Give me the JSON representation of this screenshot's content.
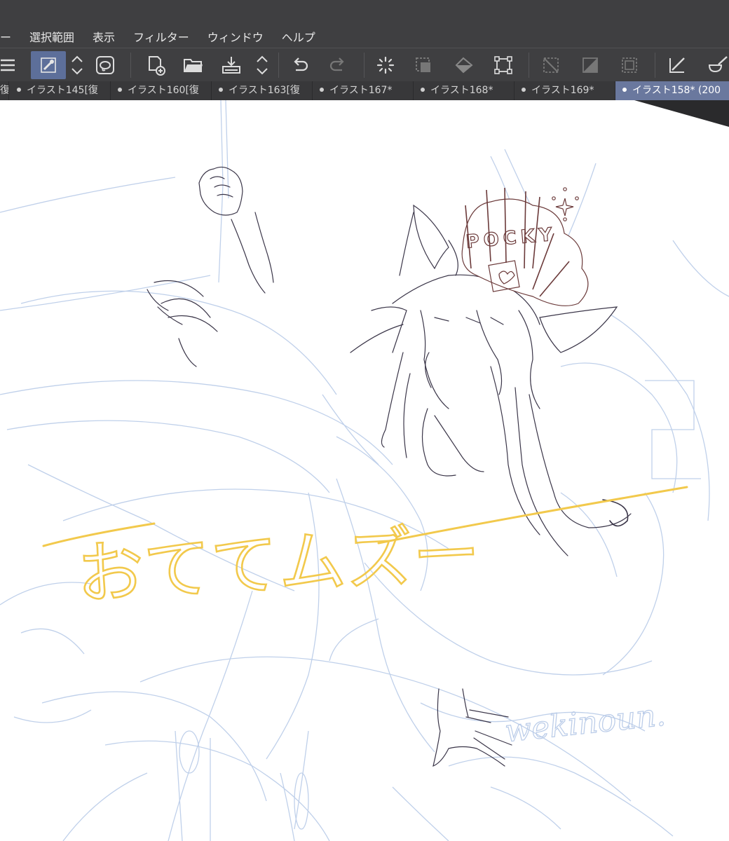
{
  "menu": {
    "items": [
      "ー",
      "選択範囲",
      "表示",
      "フィルター",
      "ウィンドウ",
      "ヘルプ"
    ]
  },
  "toolbar": {
    "icons": [
      "menu-icon",
      "transparent-color-icon",
      "stepper-icon",
      "lasso-icon",
      "new-file-icon",
      "open-folder-icon",
      "save-icon",
      "stepper-icon",
      "undo-icon",
      "redo-icon",
      "spinner-icon",
      "clear-icon",
      "fill-icon",
      "transform-icon",
      "deselect-icon",
      "invert-selection-icon",
      "show-selection-icon",
      "line-tool-icon",
      "brush-tool-icon"
    ]
  },
  "tabs": [
    {
      "label": "復",
      "active": false
    },
    {
      "label": "イラスト145[復",
      "active": false
    },
    {
      "label": "イラスト160[復",
      "active": false
    },
    {
      "label": "イラスト163[復",
      "active": false
    },
    {
      "label": "イラスト167*",
      "active": false
    },
    {
      "label": "イラスト168*",
      "active": false
    },
    {
      "label": "イラスト169*",
      "active": false
    },
    {
      "label": "イラスト158* (200",
      "active": true
    }
  ],
  "canvas": {
    "crown_text": "POCKY",
    "handwriting": "おててムズー",
    "signature": "wekinoun.",
    "colors": {
      "sketch": "#b9cbe8",
      "lineart": "#3a3548",
      "crown": "#6b3a3a",
      "annotation": "#f2c94c"
    }
  },
  "colors": {
    "chrome": "#3f3f41",
    "active_tab": "#6a789e",
    "active_tool": "#5d6f9a"
  }
}
